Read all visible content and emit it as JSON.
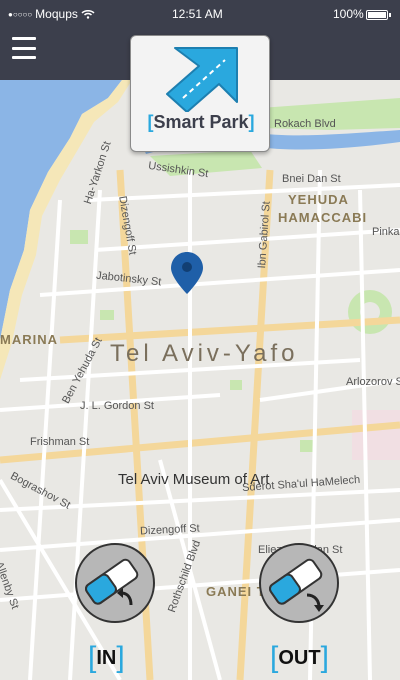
{
  "status_bar": {
    "carrier": "Moqups",
    "time": "12:51 AM",
    "battery": "100%"
  },
  "header": {
    "menu_icon": "hamburger-icon"
  },
  "app": {
    "name": "Smart Park",
    "logo_icon": "arrow-up-right-icon"
  },
  "map": {
    "city": "Tel Aviv-Yafo",
    "districts": [
      "YEHUDA",
      "HAMACCABI",
      "MARINA",
      "GANEI TZIONA"
    ],
    "landmark": "Tel Aviv Museum of Art",
    "streets": [
      "Rokach Blvd",
      "Ussishkin St",
      "Bnei Dan St",
      "Dizengoff St",
      "Ha-Yarkon St",
      "Jabotinsky St",
      "Ibn Gabirol St",
      "Pinkas St",
      "Ben Yehuda St",
      "J. L. Gordon St",
      "Frishman St",
      "Arlozorov St",
      "Bograshov St",
      "Sderot Sha'ul HaMelech",
      "Dizengoff St",
      "Allenby St",
      "Rothschild Blvd",
      "Eliezer Kaplan St"
    ],
    "pin_icon": "location-pin-icon"
  },
  "actions": {
    "in_label": "IN",
    "out_label": "OUT",
    "in_icon": "eraser-in-icon",
    "out_icon": "eraser-out-icon"
  },
  "colors": {
    "header": "#3c3f4c",
    "accent": "#2aa8de",
    "water": "#7eb2ef",
    "park": "#c8e6b0"
  }
}
